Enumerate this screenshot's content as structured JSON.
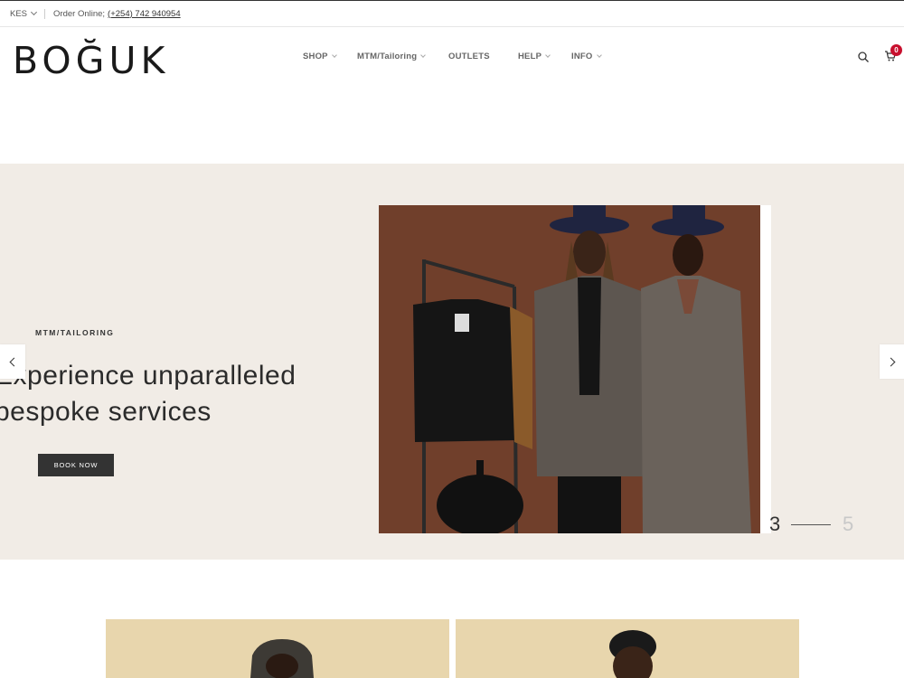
{
  "topbar": {
    "currency": "KES",
    "order_label": "Order Online;",
    "order_phone": "(+254) 742 940954"
  },
  "header": {
    "logo": "BOGÜK",
    "logo_display": "BOĞUK",
    "nav": [
      {
        "label": "SHOP"
      },
      {
        "label": "MTM/Tailoring"
      },
      {
        "label": "OUTLETS"
      },
      {
        "label": "HELP"
      },
      {
        "label": "INFO"
      }
    ],
    "cart_count": "0"
  },
  "hero": {
    "tag": "MTM/TAILORING",
    "title_line1": "Experience unparalleled",
    "title_line2": "bespoke services",
    "button_label": "BOOK NOW",
    "slide_current": "3",
    "slide_total": "5"
  },
  "colors": {
    "hero_bg": "#f1ece6",
    "button_bg": "#333333",
    "badge": "#c8102e",
    "photo_bg": "#7a4530",
    "card_bg": "#e8d6ad"
  },
  "icons": {
    "search": "search-icon",
    "cart": "cart-icon",
    "prev": "chevron-left-icon",
    "next": "chevron-right-icon"
  }
}
